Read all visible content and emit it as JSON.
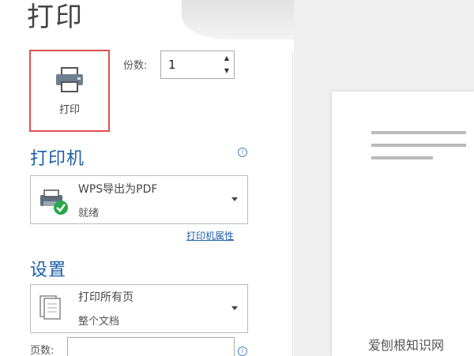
{
  "title": "打印",
  "print_button": {
    "label": "打印"
  },
  "copies": {
    "label": "份数:",
    "value": "1"
  },
  "printer_section": {
    "heading": "打印机",
    "selected_name": "WPS导出为PDF",
    "status": "就绪",
    "properties_link": "打印机属性"
  },
  "settings_section": {
    "heading": "设置",
    "range_title": "打印所有页",
    "range_subtitle": "整个文档",
    "pages_label": "页数:",
    "pages_value": ""
  },
  "watermark": "爱刨根知识网",
  "colors": {
    "accent": "#1f5fa8",
    "highlight_border": "#e05050",
    "status_ok": "#2aa84a"
  },
  "icons": [
    "printer-icon",
    "info-icon",
    "printer-check-icon",
    "pages-stack-icon",
    "caret-down-icon"
  ]
}
